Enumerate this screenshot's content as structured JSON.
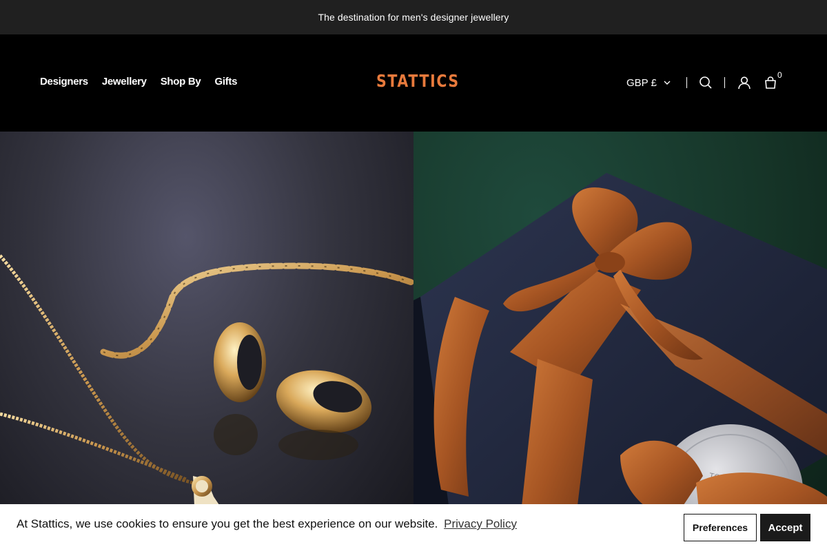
{
  "announcement": "The destination for men's designer jewellery",
  "brand": {
    "name": "STATTICS",
    "color": "#e87a3c"
  },
  "nav": {
    "items": [
      {
        "label": "Designers"
      },
      {
        "label": "Jewellery"
      },
      {
        "label": "Shop By"
      },
      {
        "label": "Gifts"
      }
    ]
  },
  "header_tools": {
    "currency": "GBP £",
    "currency_icon": "chevron-down-icon",
    "search_icon": "search-icon",
    "account_icon": "user-icon",
    "bag_icon": "shopping-bag-icon",
    "bag_count": "0"
  },
  "hero": {
    "left_image": "gold chain, hoop earrings and pendant on dark reflective surface",
    "right_image": "navy gift box tied with copper satin ribbon on green background"
  },
  "cookie_banner": {
    "message": "At Stattics, we use cookies to ensure you get the best experience on our website.",
    "link_text": "Privacy Policy",
    "preferences_label": "Preferences",
    "accept_label": "Accept"
  },
  "colors": {
    "announcement_bg": "#202020",
    "header_bg": "#000000",
    "accept_bg": "#1b1b1b"
  }
}
